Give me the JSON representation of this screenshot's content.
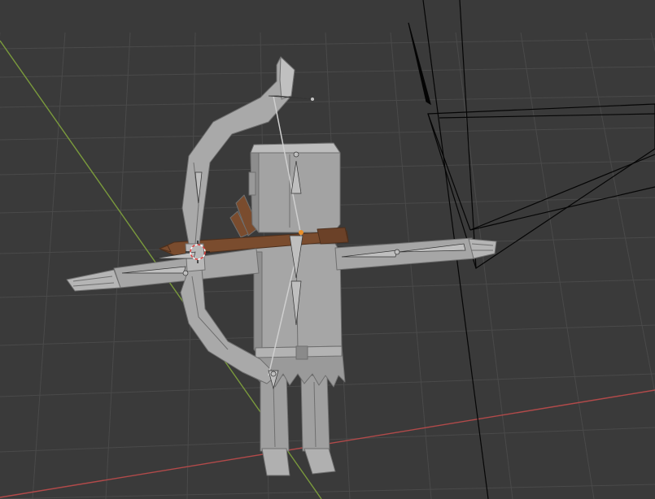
{
  "viewport": {
    "shading": "solid",
    "background_color": "#3a3a3a",
    "grid_color": "#4a4a4a",
    "x_axis_color": "#b24a4a",
    "y_axis_color": "#7a9a3c",
    "mesh_color": "#9c9c9c",
    "wood_color": "#7a4c2e",
    "camera_line_color": "#050505",
    "bone_color": "#bfbfbf"
  },
  "objects": [
    {
      "name": "character-mesh",
      "icon": "mesh-icon"
    },
    {
      "name": "bow",
      "icon": "mesh-icon"
    },
    {
      "name": "arrow",
      "icon": "mesh-icon"
    },
    {
      "name": "quiver",
      "icon": "mesh-icon"
    },
    {
      "name": "armature",
      "icon": "armature-icon"
    },
    {
      "name": "camera",
      "icon": "camera-icon"
    },
    {
      "name": "3d-cursor",
      "icon": "crosshair-icon"
    }
  ]
}
